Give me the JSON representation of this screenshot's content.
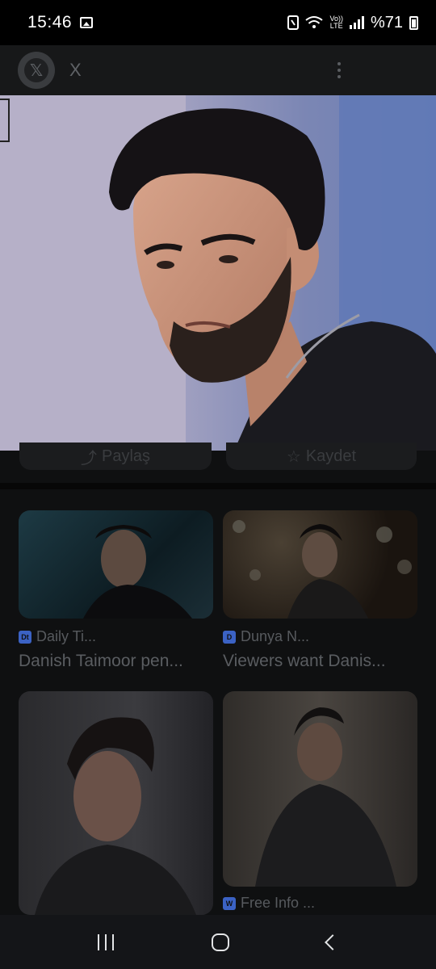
{
  "status_bar": {
    "time": "15:46",
    "volte_top": "Vo))",
    "volte_bottom": "LTE",
    "battery": "%71"
  },
  "header": {
    "title": "X"
  },
  "actions": {
    "share_label": "Paylaş",
    "save_label": "Kaydet"
  },
  "related": [
    {
      "source": "Daily Ti...",
      "title": "Danish Taimoor pen...",
      "favicon": "Dt",
      "favicon_color": "#3b62c4"
    },
    {
      "source": "Dunya N...",
      "title": "Viewers want Danis...",
      "favicon": "D",
      "favicon_color": "#3b62c4"
    },
    {
      "source": "",
      "title": "",
      "favicon": "",
      "favicon_color": "#3b62c4"
    },
    {
      "source": "Free Info ...",
      "title": "",
      "favicon": "W",
      "favicon_color": "#3b62c4"
    }
  ],
  "icons": {
    "share": "share-icon",
    "save": "star-icon",
    "back": "back-icon",
    "home": "home-icon",
    "recents": "recents-icon"
  }
}
